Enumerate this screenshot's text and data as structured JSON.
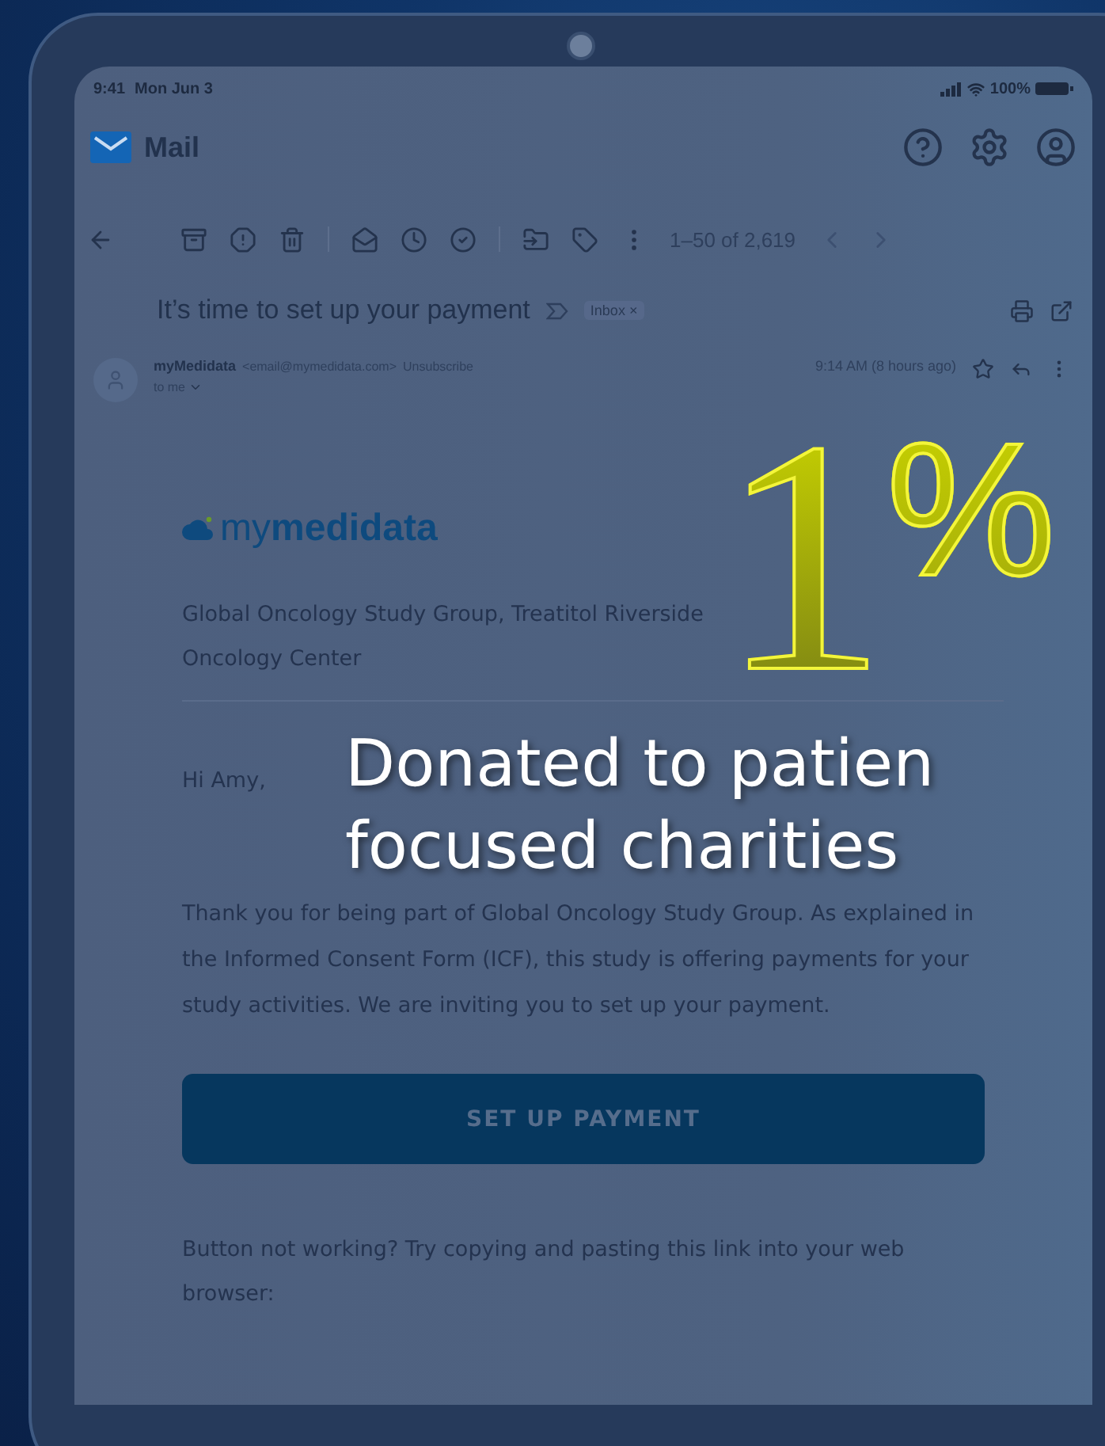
{
  "status_bar": {
    "time": "9:41",
    "date": "Mon Jun 3",
    "battery": "100%"
  },
  "app": {
    "title": "Mail"
  },
  "toolbar": {
    "range": "1–50 of 2,619"
  },
  "message": {
    "subject": "It’s time to set up your payment",
    "label": "Inbox",
    "label_remove": "×",
    "sender": {
      "name": "myMedidata",
      "email": "<email@mymedidata.com>",
      "unsubscribe": "Unsubscribe",
      "recipient": "to me",
      "time": "9:14 AM (8 hours ago)"
    }
  },
  "body": {
    "logo": {
      "light": "my",
      "bold": "medidata"
    },
    "organization": "Global Oncology Study Group, Treatitol Riverside Oncology Center",
    "greeting": "Hi Amy,",
    "paragraph": "Thank you for being part of Global Oncology Study Group. As explained in the Informed Consent Form (ICF), this study is offering payments for your study activities. We are inviting you to set up your payment.",
    "button": "SET UP PAYMENT",
    "fallback": "Button not working? Try copying and pasting this link into your web browser:"
  },
  "overlay": {
    "figure": "1$^{%}$",
    "caption": [
      "Donated to patien",
      "focused charities"
    ]
  }
}
